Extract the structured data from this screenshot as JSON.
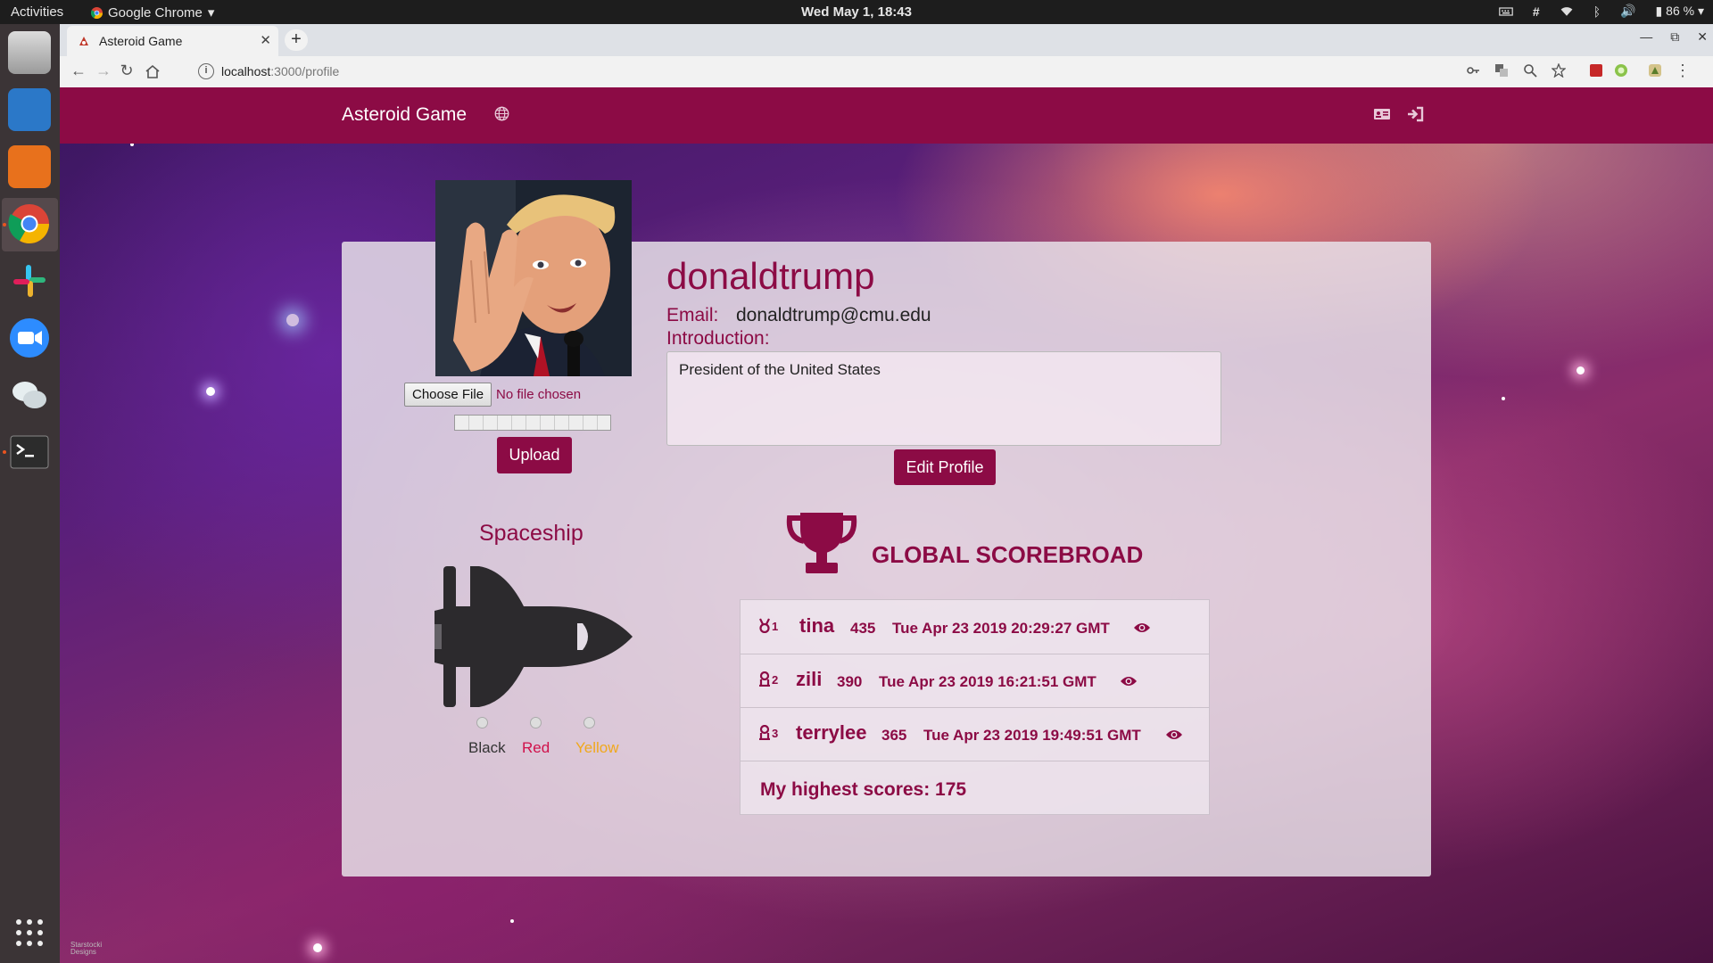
{
  "system_bar": {
    "activities": "Activities",
    "app_name": "Google Chrome",
    "clock": "Wed May  1, 18:43",
    "battery": "86 %"
  },
  "browser": {
    "tab_title": "Asteroid Game",
    "url_host": "localhost",
    "url_path": ":3000/profile"
  },
  "navbar": {
    "brand": "Asteroid Game"
  },
  "profile": {
    "username": "donaldtrump",
    "email_label": "Email:",
    "email": "donaldtrump@cmu.edu",
    "intro_label": "Introduction:",
    "intro_text": "President of the United States",
    "choose_file": "Choose File",
    "no_file": "No file chosen",
    "upload_label": "Upload",
    "edit_label": "Edit Profile"
  },
  "spaceship": {
    "title": "Spaceship",
    "options": [
      "Black",
      "Red",
      "Yellow"
    ],
    "colors": {
      "Black": "#333333",
      "Red": "#d0104a",
      "Yellow": "#f0a81c"
    }
  },
  "scoreboard": {
    "title": "GLOBAL SCOREBROAD",
    "rows": [
      {
        "rank": "1",
        "name": "tina",
        "score": "435",
        "date": "Tue Apr 23 2019 20:29:27 GMT"
      },
      {
        "rank": "2",
        "name": "zili",
        "score": "390",
        "date": "Tue Apr 23 2019 16:21:51 GMT"
      },
      {
        "rank": "3",
        "name": "terrylee",
        "score": "365",
        "date": "Tue Apr 23 2019 19:49:51 GMT"
      }
    ],
    "my_highest": "My highest scores: 175"
  },
  "theme": {
    "accent": "#8c0b45"
  },
  "icons": [
    "globe-icon",
    "id-card-icon",
    "sign-in-icon",
    "trophy-icon",
    "medal-icon",
    "eye-icon",
    "spaceship-icon"
  ]
}
